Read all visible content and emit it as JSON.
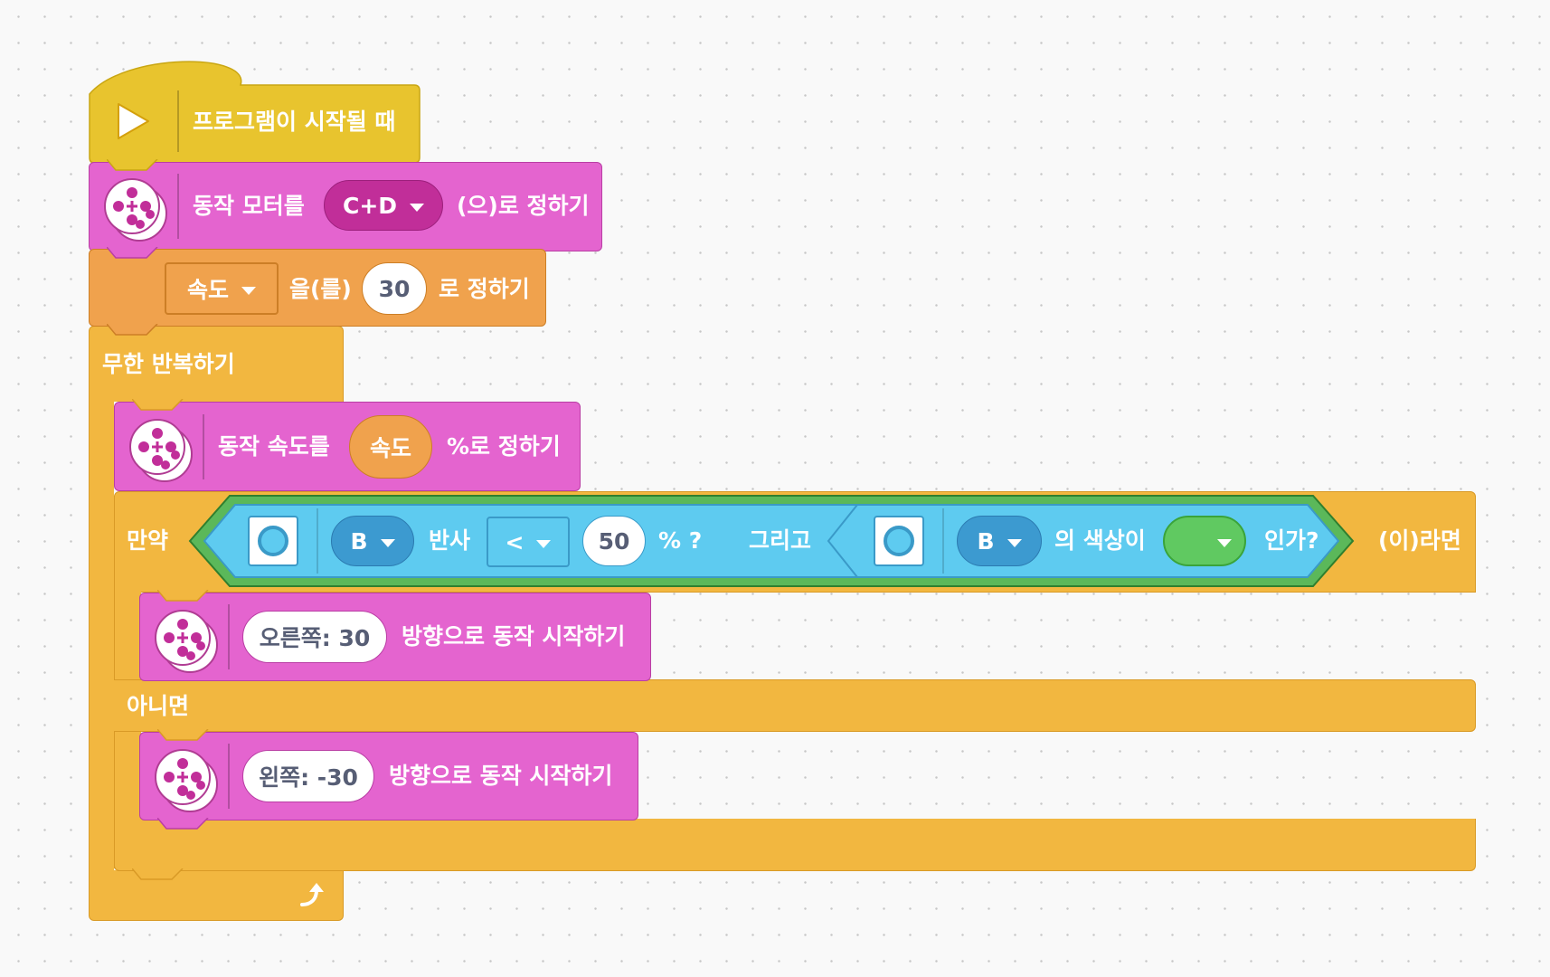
{
  "colors": {
    "event": "#e8c42e",
    "motor": "#e464cf",
    "motor_dark": "#c12e99",
    "variable": "#f0a24d",
    "control": "#f2b740",
    "sensor": "#5ecbf0",
    "sensor_dark": "#3c9ad0",
    "logic": "#5bb85a",
    "green": "#60c961"
  },
  "blocks": {
    "when_start": {
      "icon": "play-icon",
      "label": "프로그램이 시작될 때"
    },
    "set_motors": {
      "icon": "motor-pair-icon",
      "label": "동작 모터를",
      "dropdown_value": "C+D",
      "suffix": "(으)로 정하기"
    },
    "set_variable": {
      "dropdown_value": "속도",
      "middle": "을(를)",
      "value": "30",
      "suffix": "로 정하기"
    },
    "forever": {
      "label": "무한 반복하기",
      "loop_icon": "loop-arrow-icon"
    },
    "set_speed": {
      "icon": "motor-pair-icon",
      "label": "동작 속도를",
      "value": "속도",
      "suffix": "%로 정하기"
    },
    "if_else": {
      "if_label": "만약",
      "then_label": "(이)라면",
      "else_label": "아니면",
      "condition": {
        "left": {
          "icon": "color-sensor-icon",
          "port": "B",
          "label": "반사",
          "operator": "<",
          "value": "50",
          "suffix": "% ?"
        },
        "and_label": "그리고",
        "right": {
          "icon": "color-sensor-icon",
          "port": "B",
          "label": "의 색상이",
          "color_value": "#60c961",
          "suffix": "인가?"
        }
      }
    },
    "start_right": {
      "icon": "motor-pair-icon",
      "value": "오른쪽: 30",
      "suffix": "방향으로 동작 시작하기"
    },
    "start_left": {
      "icon": "motor-pair-icon",
      "value": "왼쪽: -30",
      "suffix": "방향으로 동작 시작하기"
    }
  }
}
